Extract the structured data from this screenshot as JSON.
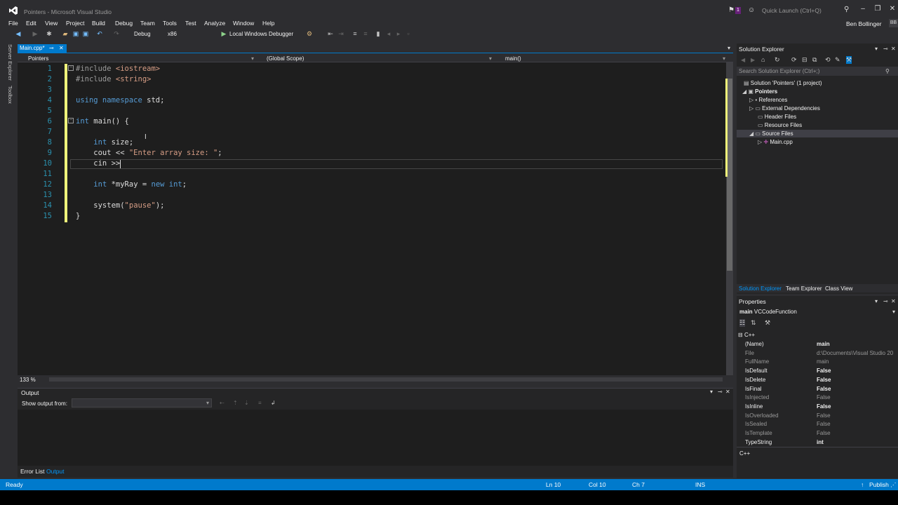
{
  "window": {
    "title": "Pointers - Microsoft Visual Studio",
    "quick_launch": "Quick Launch (Ctrl+Q)",
    "notification_count": "1",
    "user": "Ben Bollinger",
    "user_initials": "BB"
  },
  "menu": [
    "File",
    "Edit",
    "View",
    "Project",
    "Build",
    "Debug",
    "Team",
    "Tools",
    "Test",
    "Analyze",
    "Window",
    "Help"
  ],
  "toolbar": {
    "config": "Debug",
    "platform": "x86",
    "run_label": "Local Windows Debugger"
  },
  "left_strip": {
    "server_explorer": "Server Explorer",
    "toolbox": "Toolbox"
  },
  "editor": {
    "tab": "Main.cpp*",
    "nav_project": "Pointers",
    "nav_scope": "(Global Scope)",
    "nav_member": "main()",
    "zoom": "133 %",
    "line_numbers": [
      "1",
      "2",
      "3",
      "4",
      "5",
      "6",
      "7",
      "8",
      "9",
      "10",
      "11",
      "12",
      "13",
      "14",
      "15"
    ]
  },
  "output": {
    "title": "Output",
    "show_from_label": "Show output from:",
    "tabs": [
      "Error List",
      "Output"
    ]
  },
  "solution_explorer": {
    "title": "Solution Explorer",
    "search_placeholder": "Search Solution Explorer (Ctrl+;)",
    "tree": {
      "solution": "Solution 'Pointers' (1 project)",
      "project": "Pointers",
      "references": "References",
      "external": "External Dependencies",
      "headers": "Header Files",
      "resources": "Resource Files",
      "sources": "Source Files",
      "main": "Main.cpp"
    },
    "tabs": [
      "Solution Explorer",
      "Team Explorer",
      "Class View"
    ]
  },
  "properties": {
    "title": "Properties",
    "object_name": "main",
    "object_type": "VCCodeFunction",
    "category": "C++",
    "rows": [
      {
        "name": "(Name)",
        "value": "main"
      },
      {
        "name": "File",
        "value": "d:\\Documents\\Visual Studio 20"
      },
      {
        "name": "FullName",
        "value": "main"
      },
      {
        "name": "IsDefault",
        "value": "False"
      },
      {
        "name": "IsDelete",
        "value": "False"
      },
      {
        "name": "IsFinal",
        "value": "False"
      },
      {
        "name": "IsInjected",
        "value": "False"
      },
      {
        "name": "IsInline",
        "value": "False"
      },
      {
        "name": "IsOverloaded",
        "value": "False"
      },
      {
        "name": "IsSealed",
        "value": "False"
      },
      {
        "name": "IsTemplate",
        "value": "False"
      },
      {
        "name": "TypeString",
        "value": "int"
      }
    ],
    "description": "C++"
  },
  "status": {
    "ready": "Ready",
    "line": "Ln 10",
    "col": "Col 10",
    "ch": "Ch 7",
    "mode": "INS",
    "publish": "Publish"
  },
  "colors": {
    "accent": "#007acc",
    "editor_bg": "#1e1e1e",
    "chrome_bg": "#2d2d30",
    "keyword": "#569cd6",
    "string": "#d69d85",
    "line_number": "#2b91af",
    "change_marker": "#eff37a"
  }
}
